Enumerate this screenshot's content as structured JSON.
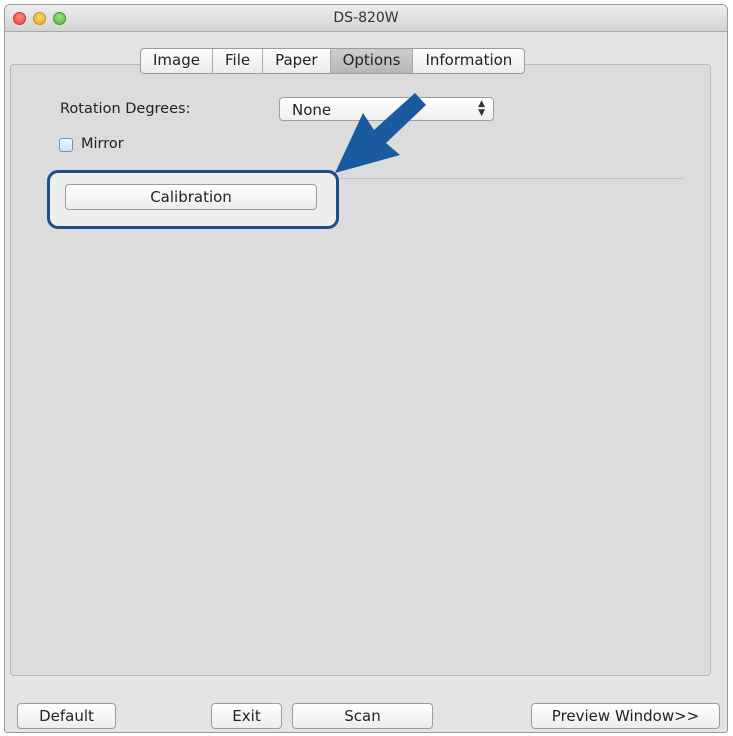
{
  "window": {
    "title": "DS-820W"
  },
  "tabs": [
    {
      "label": "Image",
      "selected": false
    },
    {
      "label": "File",
      "selected": false
    },
    {
      "label": "Paper",
      "selected": false
    },
    {
      "label": "Options",
      "selected": true
    },
    {
      "label": "Information",
      "selected": false
    }
  ],
  "options": {
    "rotation_label": "Rotation Degrees:",
    "rotation_value": "None",
    "mirror_label": "Mirror",
    "mirror_checked": false,
    "calibration_label": "Calibration"
  },
  "footer": {
    "default_label": "Default",
    "exit_label": "Exit",
    "scan_label": "Scan",
    "preview_label": "Preview Window>>"
  },
  "annotation": {
    "color": "#1a5a9e"
  }
}
